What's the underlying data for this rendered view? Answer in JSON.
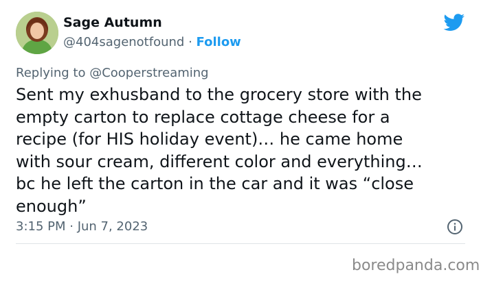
{
  "tweet": {
    "author_name": "Sage Autumn",
    "handle": "@404sagenotfound",
    "separator": "·",
    "follow_label": "Follow",
    "replying_to_prefix": "Replying to ",
    "replying_to_handle": "@Cooperstreaming",
    "text": "Sent my exhusband to the grocery store with the\nempty carton to replace cottage cheese for a\nrecipe (for HIS holiday event)… he came home\nwith sour cream, different color and everything…\nbc he left the carton in the car and it was “close\nenough”",
    "timestamp": "3:15 PM · Jun 7, 2023",
    "icons": {
      "brand": "twitter-bird-icon",
      "info": "info-icon"
    },
    "colors": {
      "accent": "#1d9bf0",
      "text": "#0f1419",
      "muted": "#536471"
    }
  },
  "watermark": "boredpanda.com"
}
